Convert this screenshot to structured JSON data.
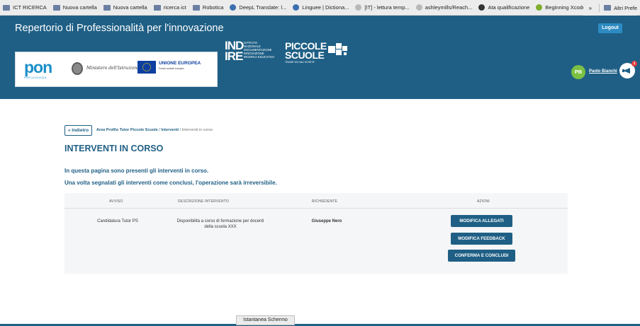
{
  "bookmarks": {
    "items": [
      {
        "label": "ICT RICERCA",
        "icon": "folder-icon"
      },
      {
        "label": "Nuova cartella",
        "icon": "folder-icon"
      },
      {
        "label": "Nuova cartella",
        "icon": "folder-icon"
      },
      {
        "label": "ricerca ict",
        "icon": "folder-icon"
      },
      {
        "label": "Robotica",
        "icon": "folder-icon"
      },
      {
        "label": "DeepL Translate: l...",
        "icon": "deepl-icon"
      },
      {
        "label": "Linguee | Dictiona...",
        "icon": "linguee-icon"
      },
      {
        "label": "[IT] - lettura temp...",
        "icon": "globe-icon"
      },
      {
        "label": "ashleymills/Reach...",
        "icon": "github-icon"
      },
      {
        "label": "Ata qualificazione",
        "icon": "target-icon"
      },
      {
        "label": "Beginning Xcode:...",
        "icon": "leaf-icon"
      }
    ],
    "overflow": "»",
    "other": "Altri Prefe"
  },
  "header": {
    "site_title": "Repertorio di Professionalità per l'innovazione",
    "logout": "Logout",
    "pon_text": "pon",
    "pon_sub": "PER LA SCUOLA",
    "ministero": "Ministero dell'Istruzione",
    "eu_title": "UNIONE EUROPEA",
    "eu_sub": "Fondo sociale europeo",
    "indire_big": "IND IRE",
    "indire_small": "ISTITUTO NAZIONALE DOCUMENTAZIONE INNOVAZIONE RICERCA EDUCATIVA",
    "ps_line1": "PICCOLE",
    "ps_line2": "SCUOLE",
    "ps_line3": "TRAME SOCIALI IN RETE",
    "avatar_initials": "PB",
    "username": "Paolo Bianchi",
    "notification_count": "1"
  },
  "main": {
    "back_label": "« Indietro",
    "breadcrumb": {
      "first": "Area Profilo Tutor Piccole Scuole",
      "sep": " / ",
      "second": "Interventi",
      "current": "Interventi in corso"
    },
    "title": "INTERVENTI IN CORSO",
    "intro1": "In questa pagina sono presenti gli interventi in corso.",
    "intro2": "Una volta segnalati gli interventi come conclusi, l'operazione sarà irreversibile.",
    "table": {
      "headers": [
        "AVVISO",
        "DESCRIZIONE INTERVENTO",
        "RICHIEDENTE",
        "AZIONI"
      ],
      "rows": [
        {
          "avviso": "Candidatura Tutor PS",
          "descrizione_1": "Disponibilità a corso di formazione per docenti",
          "descrizione_2": "della scuola XXX",
          "richiedente": "Giuseppe Nero",
          "actions": [
            "MODIFICA ALLEGATI",
            "MODIFICA FEEDBACK",
            "CONFERMA E CONCLUDI"
          ]
        }
      ]
    }
  },
  "tooltip": "Istantanea Schermo"
}
